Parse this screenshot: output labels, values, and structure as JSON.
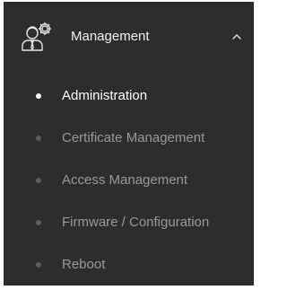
{
  "colors": {
    "panel_bg": "#2e2d2d",
    "active_text": "#ffffff",
    "inactive_text": "#9a9a9a",
    "active_dot": "#ffffff",
    "inactive_dot": "#5e5e5e"
  },
  "section": {
    "icon": "user-settings-icon",
    "label": "Management",
    "chevron_icon": "chevron-up-icon",
    "expanded": true
  },
  "items": [
    {
      "label": "Administration",
      "active": true
    },
    {
      "label": "Certificate Management",
      "active": false
    },
    {
      "label": "Access Management",
      "active": false
    },
    {
      "label": "Firmware / Configuration",
      "active": false
    },
    {
      "label": "Reboot",
      "active": false
    }
  ]
}
